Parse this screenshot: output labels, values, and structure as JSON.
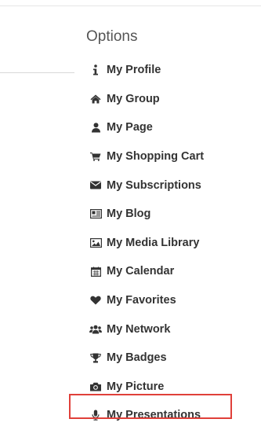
{
  "options": {
    "title": "Options",
    "items": [
      {
        "label": "My Profile",
        "icon": "info-icon"
      },
      {
        "label": "My Group",
        "icon": "home-icon"
      },
      {
        "label": "My Page",
        "icon": "user-icon"
      },
      {
        "label": "My Shopping Cart",
        "icon": "shopping-cart-icon"
      },
      {
        "label": "My Subscriptions",
        "icon": "envelope-icon"
      },
      {
        "label": "My Blog",
        "icon": "newspaper-icon"
      },
      {
        "label": "My Media Library",
        "icon": "image-icon"
      },
      {
        "label": "My Calendar",
        "icon": "calendar-icon"
      },
      {
        "label": "My Favorites",
        "icon": "heart-icon"
      },
      {
        "label": "My Network",
        "icon": "users-icon"
      },
      {
        "label": "My Badges",
        "icon": "trophy-icon"
      },
      {
        "label": "My Picture",
        "icon": "camera-icon"
      },
      {
        "label": "My Presentations",
        "icon": "microphone-icon"
      }
    ],
    "highlighted_item": "My Presentations",
    "colors": {
      "text": "#333333",
      "title": "#555555",
      "highlight_border": "#e0403a"
    }
  }
}
